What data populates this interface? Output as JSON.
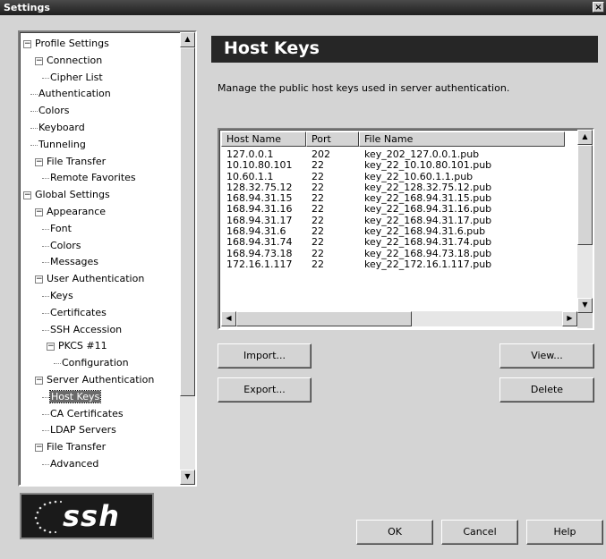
{
  "window": {
    "title": "Settings",
    "close_glyph": "×"
  },
  "tree": {
    "items": [
      {
        "label": "Profile Settings",
        "level": 0,
        "toggle": "minus"
      },
      {
        "label": "Connection",
        "level": 1,
        "toggle": "minus"
      },
      {
        "label": "Cipher List",
        "level": 2
      },
      {
        "label": "Authentication",
        "level": 1
      },
      {
        "label": "Colors",
        "level": 1
      },
      {
        "label": "Keyboard",
        "level": 1
      },
      {
        "label": "Tunneling",
        "level": 1
      },
      {
        "label": "File Transfer",
        "level": 1,
        "toggle": "minus"
      },
      {
        "label": "Remote Favorites",
        "level": 2
      },
      {
        "label": "Global Settings",
        "level": 0,
        "toggle": "minus"
      },
      {
        "label": "Appearance",
        "level": 1,
        "toggle": "minus"
      },
      {
        "label": "Font",
        "level": 2
      },
      {
        "label": "Colors",
        "level": 2
      },
      {
        "label": "Messages",
        "level": 2
      },
      {
        "label": "User Authentication",
        "level": 1,
        "toggle": "minus"
      },
      {
        "label": "Keys",
        "level": 2
      },
      {
        "label": "Certificates",
        "level": 2
      },
      {
        "label": "SSH Accession",
        "level": 2
      },
      {
        "label": "PKCS #11",
        "level": 2,
        "toggle": "minus"
      },
      {
        "label": "Configuration",
        "level": 3
      },
      {
        "label": "Server Authentication",
        "level": 1,
        "toggle": "minus"
      },
      {
        "label": "Host Keys",
        "level": 2,
        "selected": true
      },
      {
        "label": "CA Certificates",
        "level": 2
      },
      {
        "label": "LDAP Servers",
        "level": 2
      },
      {
        "label": "File Transfer",
        "level": 1,
        "toggle": "minus"
      },
      {
        "label": "Advanced",
        "level": 2
      }
    ]
  },
  "logo": {
    "text": "ssh"
  },
  "main": {
    "title": "Host Keys",
    "description": "Manage the public host keys used in server authentication."
  },
  "hostkeys": {
    "columns": [
      "Host Name",
      "Port",
      "File Name"
    ],
    "rows": [
      [
        "127.0.0.1",
        "202",
        "key_202_127.0.0.1.pub"
      ],
      [
        "10.10.80.101",
        "22",
        "key_22_10.10.80.101.pub"
      ],
      [
        "10.60.1.1",
        "22",
        "key_22_10.60.1.1.pub"
      ],
      [
        "128.32.75.12",
        "22",
        "key_22_128.32.75.12.pub"
      ],
      [
        "168.94.31.15",
        "22",
        "key_22_168.94.31.15.pub"
      ],
      [
        "168.94.31.16",
        "22",
        "key_22_168.94.31.16.pub"
      ],
      [
        "168.94.31.17",
        "22",
        "key_22_168.94.31.17.pub"
      ],
      [
        "168.94.31.6",
        "22",
        "key_22_168.94.31.6.pub"
      ],
      [
        "168.94.31.74",
        "22",
        "key_22_168.94.31.74.pub"
      ],
      [
        "168.94.73.18",
        "22",
        "key_22_168.94.73.18.pub"
      ],
      [
        "172.16.1.117",
        "22",
        "key_22_172.16.1.117.pub"
      ]
    ]
  },
  "buttons": {
    "import": "Import...",
    "export": "Export...",
    "view": "View...",
    "delete": "Delete",
    "ok": "OK",
    "cancel": "Cancel",
    "help": "Help"
  }
}
